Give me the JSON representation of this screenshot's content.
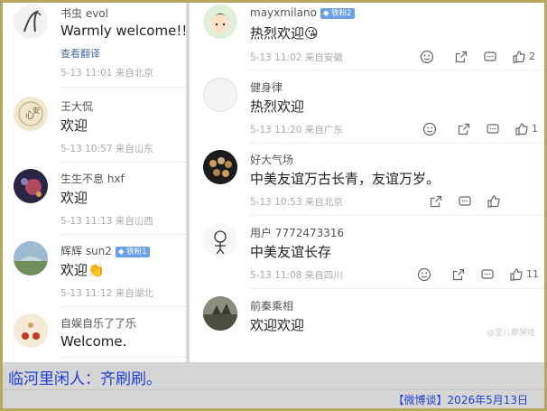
{
  "left_comments": [
    {
      "username": "书虫 evol",
      "text": "Warmly welcome!!!",
      "translate": "查看翻译",
      "meta": "5-13 11:01  来自北京"
    },
    {
      "username": "王大侃",
      "text": "欢迎",
      "meta": "5-13 10:57  来自山东"
    },
    {
      "username": "生生不息 hxf",
      "text": "欢迎",
      "meta": "5-13 11:13  来自山西"
    },
    {
      "username": "辉辉 sun2",
      "badge": "铁粉1",
      "text": "欢迎👏",
      "meta": "5-13 11:12  来自湖北"
    },
    {
      "username": "自娱自乐了了乐",
      "text": "Welcome."
    }
  ],
  "right_comments": [
    {
      "username": "mayxmilano",
      "badge": "铁粉2",
      "text": "热烈欢迎😘",
      "meta": "5-13 11:02  来自安徽",
      "likes": "2"
    },
    {
      "username": "健身律",
      "text": "热烈欢迎",
      "meta": "5-13 11:20  来自广东",
      "likes": "1"
    },
    {
      "username": "好大气场",
      "text": "中美友谊万古长青，友谊万岁。",
      "meta": "5-13 10:53  来自北京",
      "likes": ""
    },
    {
      "username": "用户 7772473316",
      "text": "中美友谊长存",
      "meta": "5-13 11:08  来自四川",
      "likes": "11"
    },
    {
      "username": "前秦乘相",
      "text": "欢迎欢迎"
    }
  ],
  "watermark": "@堂儿都哭哈",
  "caption": "临河里闲人：齐刷刷。",
  "credit": "【微博谈】2026年5月13日",
  "icons": [
    "smile-icon",
    "share-icon",
    "comment-icon",
    "like-icon"
  ]
}
